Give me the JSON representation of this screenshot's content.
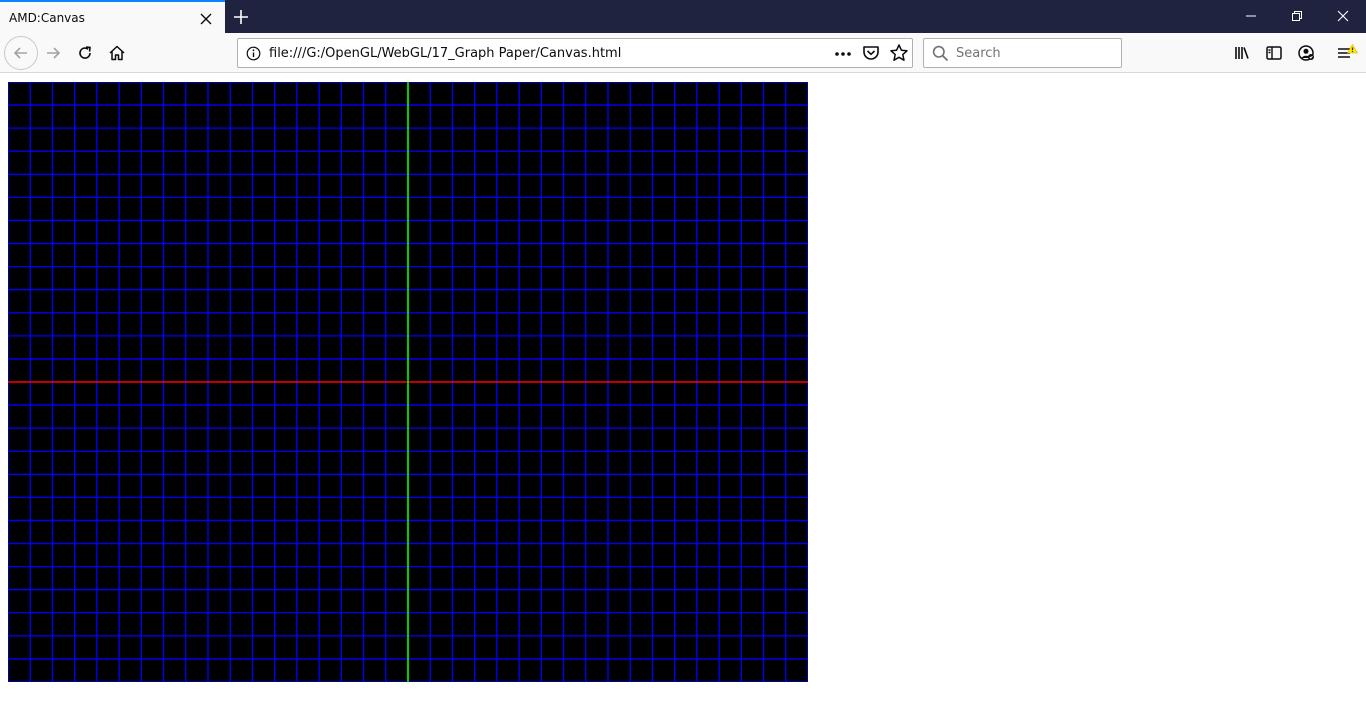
{
  "tab": {
    "title": "AMD:Canvas"
  },
  "toolbar": {
    "url": "file:///G:/OpenGL/WebGL/17_Graph Paper/Canvas.html",
    "search_placeholder": "Search"
  },
  "icons": {
    "tab_close": "close-icon",
    "new_tab": "plus-icon",
    "back": "arrow-left-icon",
    "forward": "arrow-right-icon",
    "reload": "reload-icon",
    "home": "home-icon",
    "info": "info-icon",
    "page_actions": "ellipsis-icon",
    "pocket": "pocket-icon",
    "bookmark": "star-icon",
    "search": "search-icon",
    "library": "library-icon",
    "sidebar": "sidebar-icon",
    "account": "account-icon",
    "menu": "hamburger-menu-icon"
  },
  "graph_paper": {
    "background": "#000000",
    "grid_color": "#0000ff",
    "x_axis_color": "#ff0000",
    "y_axis_color": "#00ff00",
    "vertical_lines_per_half": 18,
    "horizontal_lines_per_half": 13
  }
}
